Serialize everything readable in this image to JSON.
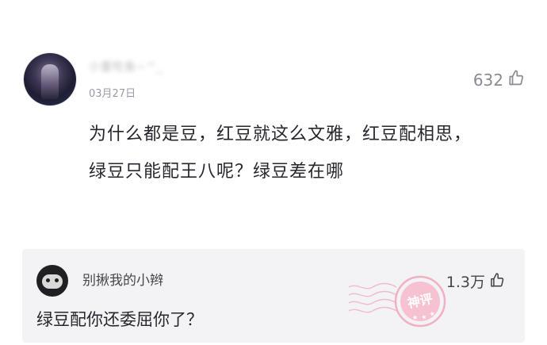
{
  "post": {
    "username": "小蕾吃鱼~^_",
    "date": "03月27日",
    "likes": "632",
    "text_line1": "为什么都是豆，红豆就这么文雅，红豆配相思，",
    "text_line2": "绿豆只能配王八呢？绿豆差在哪"
  },
  "reply": {
    "username": "别揪我的小辫",
    "likes": "1.3万",
    "text": "绿豆配你还委屈你了？"
  },
  "stamp": {
    "label": "神评",
    "color": "#f2a7bf"
  },
  "icons": {
    "like": "thumbs-up-icon"
  }
}
